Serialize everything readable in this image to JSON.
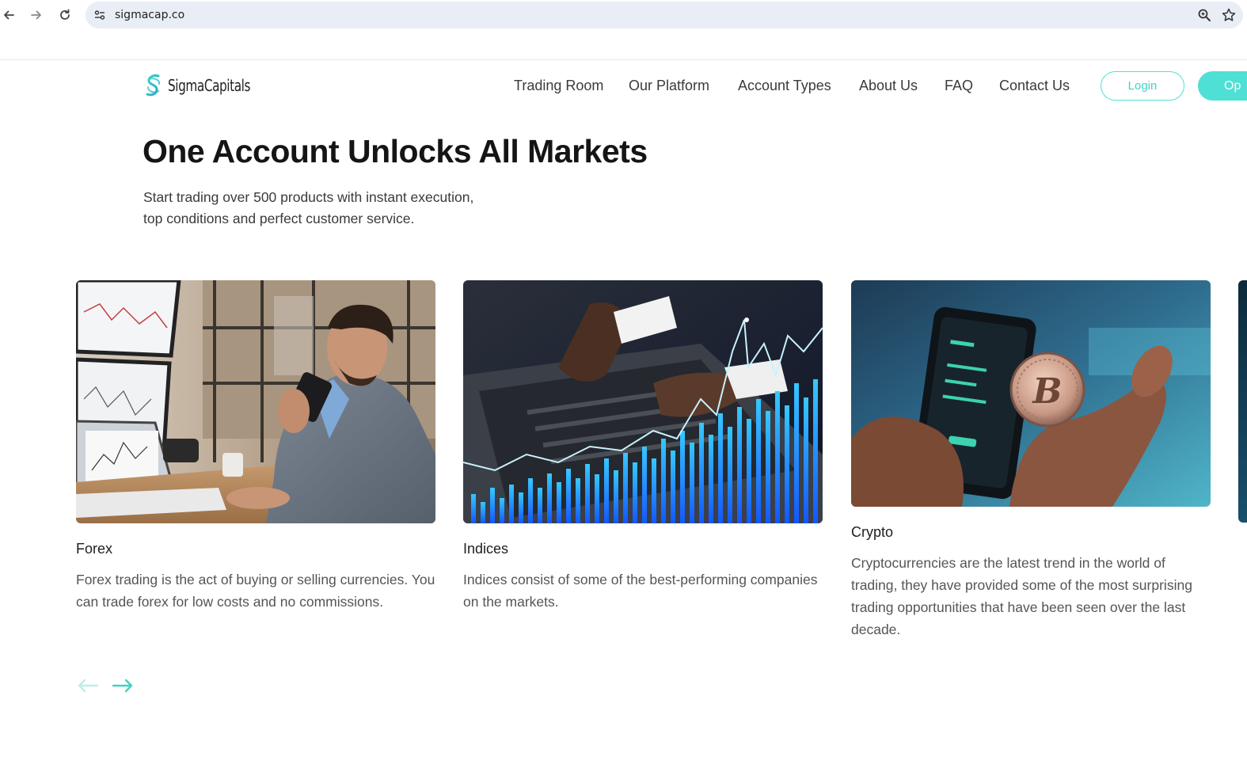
{
  "browser": {
    "url": "sigmacap.co"
  },
  "header": {
    "logo_text": "SigmaCapitals",
    "menu": [
      {
        "label": "Trading Room"
      },
      {
        "label": "Our Platform"
      },
      {
        "label": "Account Types"
      },
      {
        "label": "About Us"
      },
      {
        "label": "FAQ"
      },
      {
        "label": "Contact Us"
      }
    ],
    "login_label": "Login",
    "open_label": "Op"
  },
  "hero": {
    "title": "One Account Unlocks All Markets",
    "subtitle_line1": "Start trading over 500 products with instant execution,",
    "subtitle_line2": "top conditions and perfect customer service."
  },
  "cards": [
    {
      "title": "Forex",
      "description": "Forex trading is the act of buying or selling currencies. You can trade forex for low costs and no commissions."
    },
    {
      "title": "Indices",
      "description": "Indices consist of some of the best-performing companies on the markets."
    },
    {
      "title": "Crypto",
      "description": "Cryptocurrencies are the latest trend in the world of trading, they have provided some of the most surprising trading opportunities that have been seen over the last decade."
    }
  ],
  "colors": {
    "accent": "#4ee0d4",
    "heading": "#151515"
  },
  "icons": {
    "back": "arrow-left-icon",
    "forward": "arrow-right-icon",
    "reload": "reload-icon",
    "site_info": "tune-icon",
    "zoom": "zoom-icon",
    "bookmark": "star-icon",
    "carousel_prev": "arrow-left-icon",
    "carousel_next": "arrow-right-icon"
  }
}
